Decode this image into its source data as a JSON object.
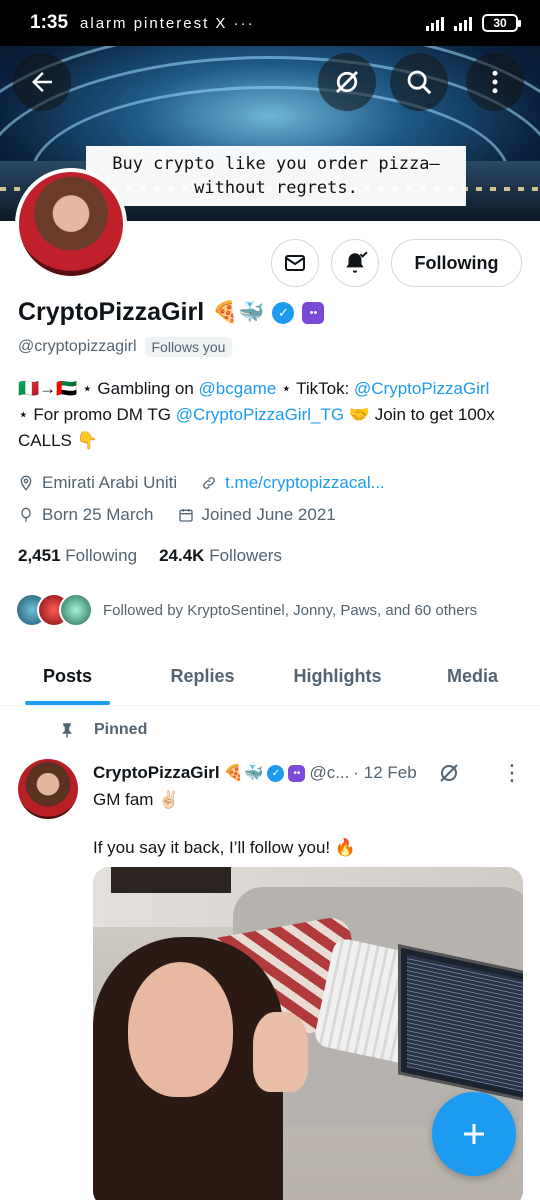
{
  "status_bar": {
    "time": "1:35",
    "battery": "30",
    "notif_icons": "alarm pinterest X ···"
  },
  "banner": {
    "caption": "Buy crypto like you order pizza—without regrets."
  },
  "profile": {
    "name": "CryptoPizzaGirl",
    "name_emojis": "🍕🐳",
    "handle": "@cryptopizzagirl",
    "follows_you": "Follows you",
    "following_button": "Following",
    "bio_line1_prefix": "🇮🇹→🇦🇪 ⋆ Gambling on ",
    "bio_link1": "@bcgame",
    "bio_line1_mid": " ⋆ TikTok: ",
    "bio_link2": "@CryptoPizzaGirl",
    "bio_line2_prefix": "⋆ For promo DM TG ",
    "bio_link3": "@CryptoPizzaGirl_TG",
    "bio_line2_suffix": " 🤝 Join to get 100x CALLS 👇",
    "location": "Emirati Arabi Uniti",
    "website": "t.me/cryptopizzacal...",
    "born": "Born 25 March",
    "joined": "Joined June 2021",
    "following_count": "2,451",
    "following_label": "Following",
    "followers_count": "24.4K",
    "followers_label": "Followers",
    "followed_by": "Followed by KryptoSentinel, Jonny, Paws, and 60 others"
  },
  "tabs": [
    "Posts",
    "Replies",
    "Highlights",
    "Media"
  ],
  "pinned_tweet": {
    "pinned_label": "Pinned",
    "author": "CryptoPizzaGirl",
    "author_emojis": "🍕🐳",
    "handle_trunc": "@c...",
    "date": "· 12 Feb",
    "text_line1": "GM fam ✌🏻",
    "text_line2": "If you say it back, I’ll follow you! 🔥"
  },
  "colors": {
    "accent": "#1d9bf0",
    "text": "#0f1419",
    "muted": "#536471",
    "badge_purple": "#7b4bd8"
  }
}
